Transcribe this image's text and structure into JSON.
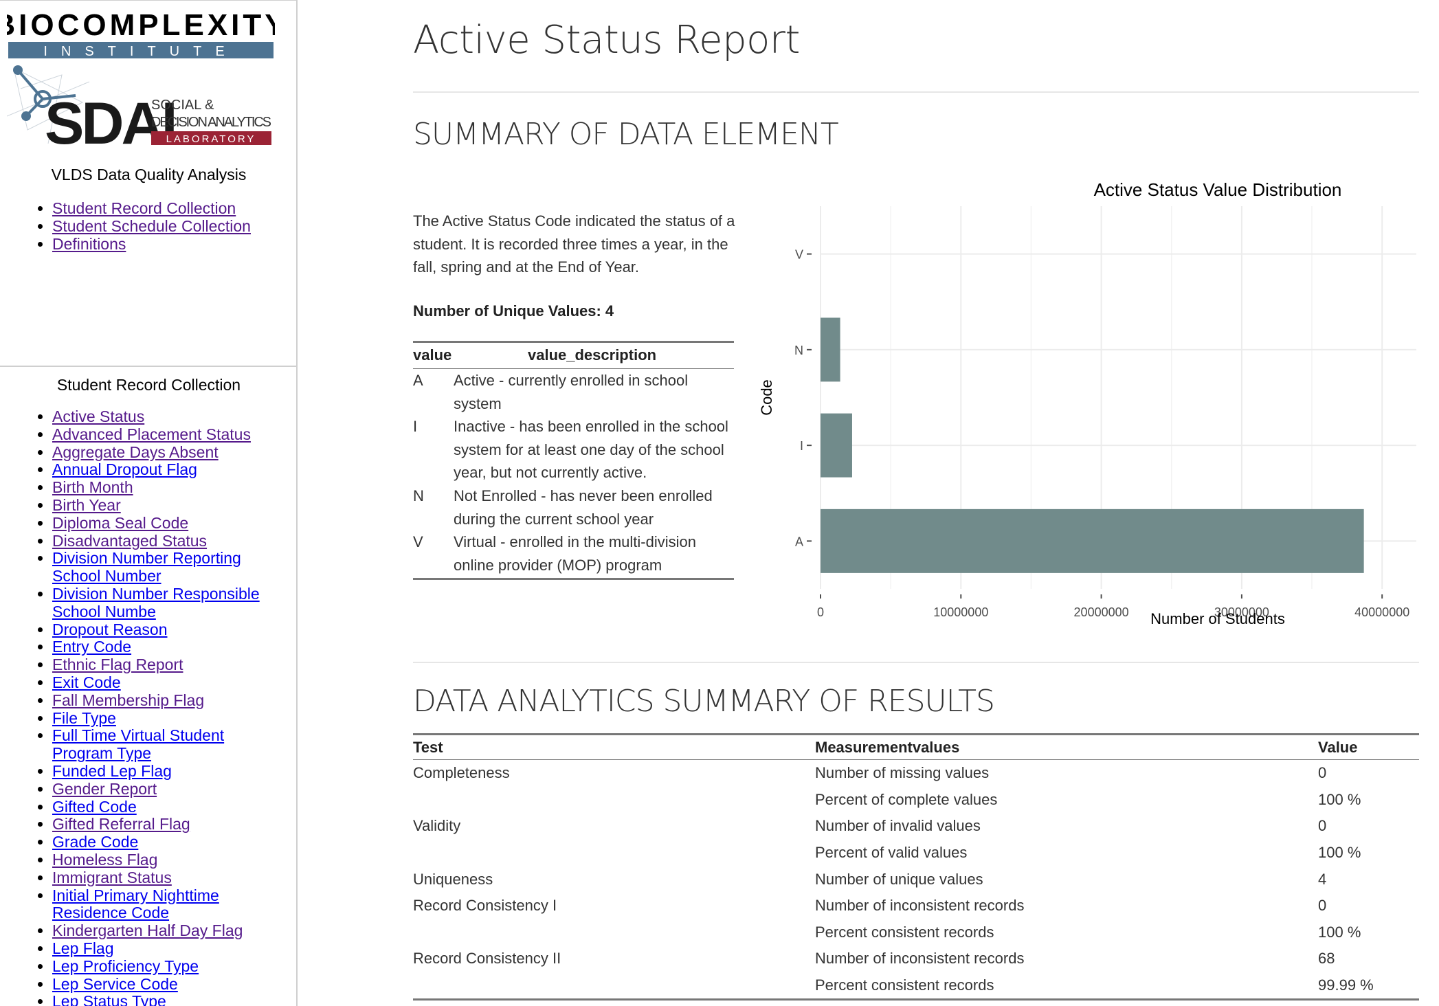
{
  "sidebar": {
    "logo": {
      "line1": "BIOCOMPLEXITY",
      "line2": "INSTITUTE",
      "acronym": "SDAL",
      "tag1": "SOCIAL &",
      "tag2": "DECISION ANALYTICS",
      "tag3": "LABORATORY"
    },
    "top_title": "VLDS Data Quality Analysis",
    "top_links": [
      {
        "label": "Student Record Collection",
        "visited": true
      },
      {
        "label": "Student Schedule Collection",
        "visited": true
      },
      {
        "label": "Definitions",
        "visited": true
      }
    ],
    "section_title": "Student Record Collection",
    "section_links": [
      {
        "label": "Active Status",
        "visited": true
      },
      {
        "label": "Advanced Placement Status",
        "visited": true
      },
      {
        "label": "Aggregate Days Absent",
        "visited": true
      },
      {
        "label": "Annual Dropout Flag",
        "visited": false
      },
      {
        "label": "Birth Month",
        "visited": true
      },
      {
        "label": "Birth Year",
        "visited": true
      },
      {
        "label": "Diploma Seal Code",
        "visited": true
      },
      {
        "label": "Disadvantaged Status",
        "visited": true
      },
      {
        "label": "Division Number Reporting School Number",
        "lines": [
          "Division Number Reporting",
          "School Number"
        ],
        "visited": false
      },
      {
        "label": "Division Number Responsible School Numbe",
        "lines": [
          "Division Number Responsible",
          "School Numbe"
        ],
        "visited": false
      },
      {
        "label": "Dropout Reason",
        "visited": false
      },
      {
        "label": "Entry Code",
        "visited": false
      },
      {
        "label": "Ethnic Flag Report",
        "visited": true
      },
      {
        "label": "Exit Code",
        "visited": false
      },
      {
        "label": "Fall Membership Flag",
        "visited": true
      },
      {
        "label": "File Type",
        "visited": false
      },
      {
        "label": "Full Time Virtual Student Program Type",
        "lines": [
          "Full Time Virtual Student",
          "Program Type"
        ],
        "visited": false
      },
      {
        "label": "Funded Lep Flag",
        "visited": false
      },
      {
        "label": "Gender Report",
        "visited": true
      },
      {
        "label": "Gifted Code",
        "visited": false
      },
      {
        "label": "Gifted Referral Flag",
        "visited": true
      },
      {
        "label": "Grade Code",
        "visited": false
      },
      {
        "label": "Homeless Flag",
        "visited": true
      },
      {
        "label": "Immigrant Status",
        "visited": true
      },
      {
        "label": "Initial Primary Nighttime Residence Code",
        "lines": [
          "Initial Primary Nighttime",
          "Residence Code"
        ],
        "visited": false
      },
      {
        "label": "Kindergarten Half Day Flag",
        "visited": true
      },
      {
        "label": "Lep Flag",
        "visited": false
      },
      {
        "label": "Lep Proficiency Type",
        "visited": false
      },
      {
        "label": "Lep Service Code",
        "visited": false
      },
      {
        "label": "Lep Status Type",
        "visited": false
      }
    ]
  },
  "main": {
    "title": "Active Status Report",
    "summary_heading": "SUMMARY OF DATA ELEMENT",
    "description": "The Active Status Code indicated the status of a student. It is recorded three times a year, in the fall, spring and at the End of Year.",
    "unique_values_label": "Number of Unique Values: 4",
    "value_table": {
      "headers": [
        "value",
        "value_description"
      ],
      "rows": [
        [
          "A",
          "Active - currently enrolled in school system"
        ],
        [
          "I",
          "Inactive - has been enrolled in the school system for at least one day of the school year, but not currently active."
        ],
        [
          "N",
          "Not Enrolled - has never been enrolled during the current school year"
        ],
        [
          "V",
          "Virtual - enrolled in the multi-division online provider (MOP) program"
        ]
      ]
    },
    "results_heading": "DATA ANALYTICS SUMMARY OF RESULTS",
    "results_table": {
      "headers": [
        "Test",
        "Measurementvalues",
        "Value"
      ],
      "rows": [
        [
          "Completeness",
          "Number of missing values",
          "0"
        ],
        [
          "",
          "Percent of complete values",
          "100 %"
        ],
        [
          "Validity",
          "Number of invalid values",
          "0"
        ],
        [
          "",
          "Percent of valid values",
          "100 %"
        ],
        [
          "Uniqueness",
          "Number of unique values",
          "4"
        ],
        [
          "Record Consistency I",
          "Number of inconsistent records",
          "0"
        ],
        [
          "",
          "Percent consistent records",
          "100 %"
        ],
        [
          "Record Consistency II",
          "Number of inconsistent records",
          "68"
        ],
        [
          "",
          "Percent consistent records",
          "99.99 %"
        ]
      ]
    }
  },
  "chart_data": {
    "type": "bar",
    "orientation": "horizontal",
    "title": "Active Status Value Distribution",
    "xlabel": "Number of Students",
    "ylabel": "Code",
    "categories": [
      "A",
      "I",
      "N",
      "V"
    ],
    "values": [
      38700000,
      2250000,
      1400000,
      0
    ],
    "xlim": [
      0,
      40000000
    ],
    "xticks": [
      "0",
      "10000000",
      "20000000",
      "30000000",
      "40000000"
    ],
    "bar_color": "#718b8b",
    "grid": true
  },
  "colors": {
    "link_visited": "#551a8b",
    "link_unvisited": "#0000ee",
    "logo_blue": "#4d7392",
    "logo_red": "#9b2335"
  }
}
